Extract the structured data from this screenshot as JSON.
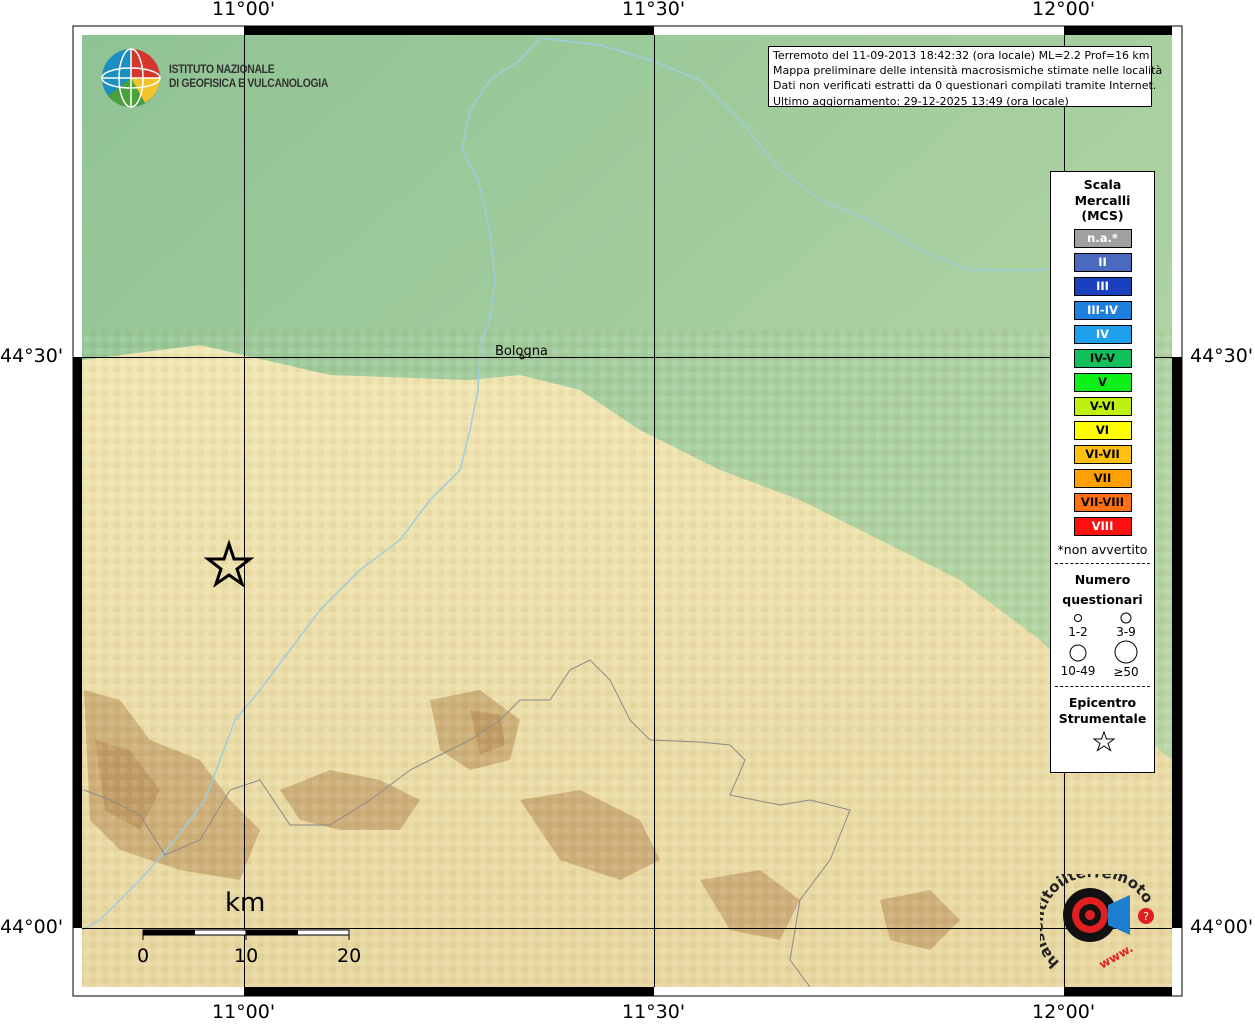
{
  "map": {
    "lon_labels": [
      "11°00'",
      "11°30'",
      "12°00'"
    ],
    "lat_labels": [
      "44°30'",
      "44°00'"
    ],
    "city": "Bologna",
    "epicenter_marker": "star-icon"
  },
  "logo": {
    "line1": "ISTITUTO NAZIONALE",
    "line2": "DI GEOFISICA E VULCANOLOGIA"
  },
  "info": {
    "line1": "Terremoto del 11-09-2013 18:42:32 (ora locale) ML=2.2 Prof=16 km",
    "line2": "Mappa preliminare delle intensità macrosismiche stimate nelle località",
    "line3": "Dati non verificati estratti da 0 questionari compilati tramite Internet.",
    "line4": "Ultimo aggiornamento: 29-12-2025 13:49 (ora locale)"
  },
  "legend": {
    "title_1": "Scala",
    "title_2": "Mercalli",
    "title_3": "(MCS)",
    "classes": [
      {
        "label": "n.a.*",
        "color": "#a0a0a0",
        "text": "#ffffff"
      },
      {
        "label": "II",
        "color": "#4a6abf",
        "text": "#ffffff"
      },
      {
        "label": "III",
        "color": "#1a3fbf",
        "text": "#ffffff"
      },
      {
        "label": "III-IV",
        "color": "#1f7fdf",
        "text": "#ffffff"
      },
      {
        "label": "IV",
        "color": "#1ea0ef",
        "text": "#ffffff"
      },
      {
        "label": "IV-V",
        "color": "#11c05a",
        "text": "#000000"
      },
      {
        "label": "V",
        "color": "#0ff018",
        "text": "#000000"
      },
      {
        "label": "V-VI",
        "color": "#c0f010",
        "text": "#000000"
      },
      {
        "label": "VI",
        "color": "#ffff00",
        "text": "#000000"
      },
      {
        "label": "VI-VII",
        "color": "#ffc010",
        "text": "#000000"
      },
      {
        "label": "VII",
        "color": "#ffa000",
        "text": "#000000"
      },
      {
        "label": "VII-VIII",
        "color": "#ff7010",
        "text": "#000000"
      },
      {
        "label": "VIII",
        "color": "#ff1010",
        "text": "#ffffff"
      }
    ],
    "note": "*non avvertito",
    "count_title_1": "Numero",
    "count_title_2": "questionari",
    "count_labels": [
      "1-2",
      "3-9",
      "10-49",
      "≥50"
    ],
    "epi_title_1": "Epicentro",
    "epi_title_2": "Strumentale"
  },
  "scalebar": {
    "unit": "km",
    "ticks": [
      "0",
      "10",
      "20"
    ]
  },
  "hsit_logo": {
    "text": "haisentitoilterremoto.it",
    "url_text": "www."
  },
  "colors": {
    "river": "#9ecde0",
    "border": "#8a8a8a",
    "plain": "#9bc79b",
    "hills": "#ecdfa8",
    "mountains": "#b9925a"
  }
}
